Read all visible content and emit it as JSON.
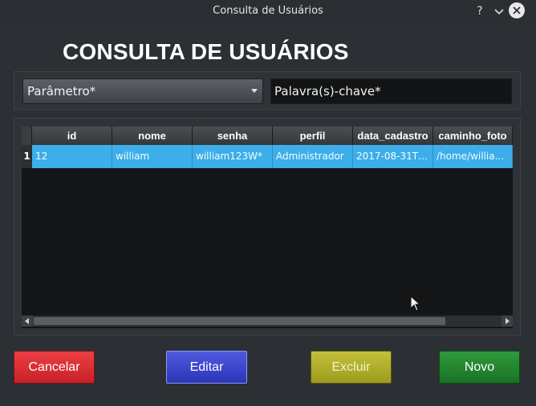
{
  "window": {
    "title": "Consulta de Usuários",
    "help_glyph": "?",
    "minimize_glyph": "∨"
  },
  "heading": "CONSULTA DE USUÁRIOS",
  "search": {
    "parameter_selected": "Parâmetro*",
    "keyword_value": "Palavra(s)-chave*"
  },
  "table": {
    "columns": [
      "id",
      "nome",
      "senha",
      "perfil",
      "data_cadastro",
      "caminho_foto"
    ],
    "rows": [
      {
        "row_number": "1",
        "cells": [
          "12",
          "william",
          "william123W*",
          "Administrador",
          "2017-08-31T1...",
          "/home/willia..."
        ]
      }
    ],
    "selection_color": "#3daee9"
  },
  "buttons": {
    "cancel": "Cancelar",
    "edit": "Editar",
    "delete": "Excluir",
    "new": "Novo"
  },
  "colors": {
    "cancel": "#d7282f",
    "edit": "#3440c9",
    "delete": "#b1ae27",
    "new": "#238530"
  },
  "icons": [
    "help-icon",
    "minimize-icon",
    "close-icon",
    "combo-arrow-icon",
    "mouse-cursor-icon"
  ]
}
